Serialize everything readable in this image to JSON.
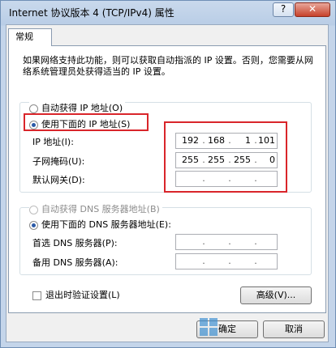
{
  "window": {
    "title": "Internet 协议版本 4 (TCP/IPv4) 属性",
    "help_glyph": "?",
    "close_glyph": "✕"
  },
  "tab": {
    "label": "常规"
  },
  "description": "如果网络支持此功能，则可以获取自动指派的 IP 设置。否则，您需要从网络系统管理员处获得适当的 IP 设置。",
  "ip": {
    "auto_label": "自动获得 IP 地址(O)",
    "manual_label": "使用下面的 IP 地址(S)",
    "address_label": "IP 地址(I):",
    "address": [
      "192",
      "168",
      "1",
      "101"
    ],
    "mask_label": "子网掩码(U):",
    "mask": [
      "255",
      "255",
      "255",
      "0"
    ],
    "gateway_label": "默认网关(D):",
    "gateway": [
      "",
      "",
      "",
      ""
    ]
  },
  "dns": {
    "auto_label": "自动获得 DNS 服务器地址(B)",
    "manual_label": "使用下面的 DNS 服务器地址(E):",
    "preferred_label": "首选 DNS 服务器(P):",
    "preferred": [
      "",
      "",
      "",
      ""
    ],
    "alternate_label": "备用 DNS 服务器(A):",
    "alternate": [
      "",
      "",
      "",
      ""
    ]
  },
  "validate_label": "退出时验证设置(L)",
  "advanced_label": "高级(V)...",
  "ok_label": "确定",
  "cancel_label": "取消",
  "colors": {
    "highlight": "#d9252a",
    "accent": "#2b5aa7"
  }
}
